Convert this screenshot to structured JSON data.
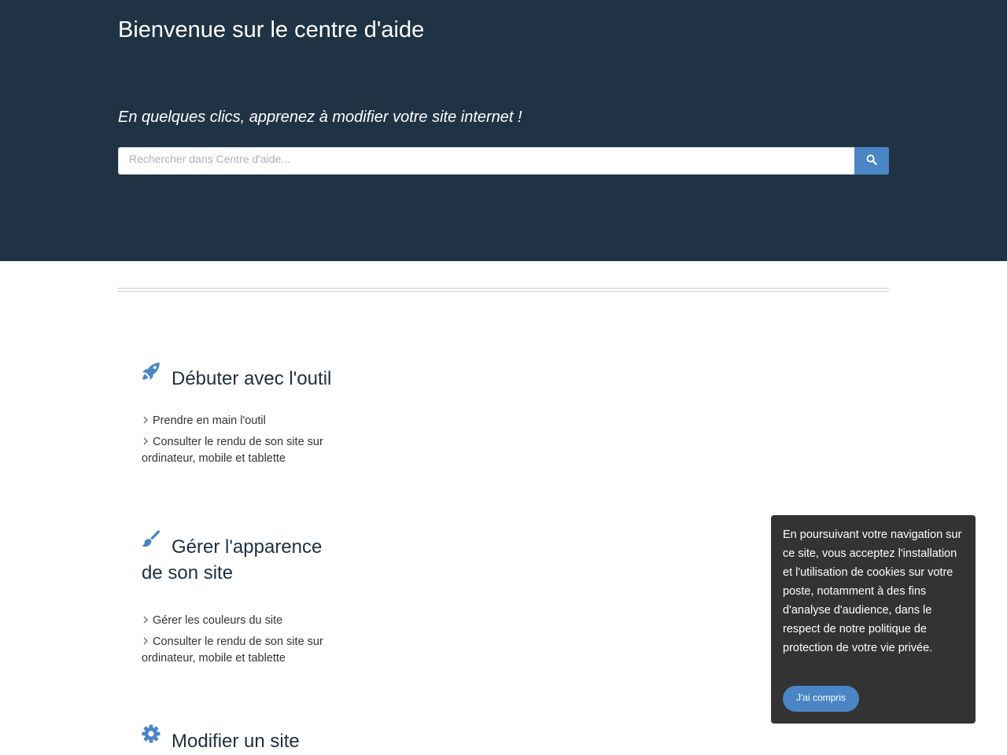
{
  "hero": {
    "title": "Bienvenue sur le centre d'aide",
    "subtitle": "En quelques clics, apprenez à modifier votre site internet !",
    "search_placeholder": "Rechercher dans Centre d'aide..."
  },
  "colors": {
    "hero_background": "#203344",
    "accent": "#4a86c5",
    "cookie_background": "#333333"
  },
  "sections": [
    {
      "icon": "rocket-icon",
      "title": "Débuter avec l'outil",
      "links": [
        "Prendre en main l'outil",
        "Consulter le rendu de son site sur ordinateur, mobile et tablette"
      ]
    },
    {
      "icon": "paintbrush-icon",
      "title": "Gérer l'apparence de son site",
      "links": [
        "Gérer les couleurs du site",
        "Consulter le rendu de son site sur ordinateur, mobile et tablette"
      ]
    },
    {
      "icon": "gear-icon",
      "title": "Modifier un site",
      "links": []
    }
  ],
  "cookie": {
    "text": "En poursuivant votre navigation sur ce site, vous acceptez l'installation et l'utilisation de cookies sur votre poste, notamment à des fins d'analyse d'audience, dans le respect de notre politique de protection de votre vie privée.",
    "button_label": "J'ai compris"
  }
}
